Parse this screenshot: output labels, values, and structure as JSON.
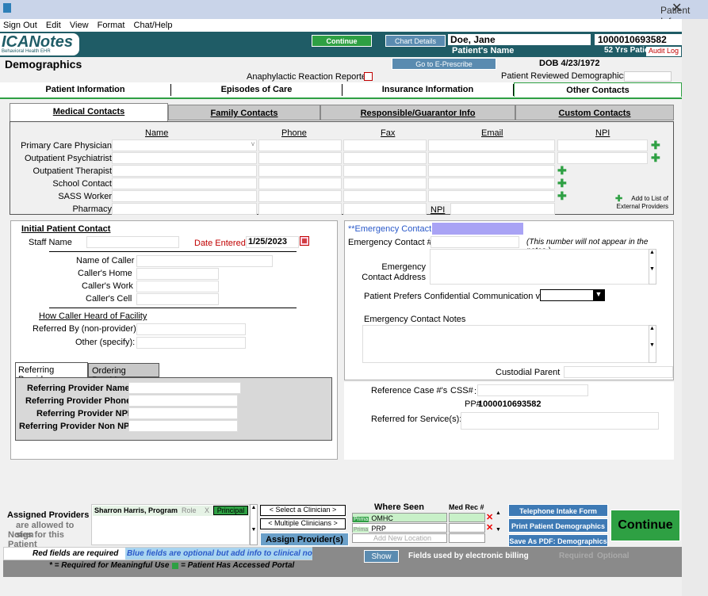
{
  "window": {
    "title": "Patient Info"
  },
  "menu": [
    "Sign Out",
    "Edit",
    "View",
    "Format",
    "Chat/Help"
  ],
  "header": {
    "logo": "ICANotes",
    "logo_sub": "Behavioral Health EHR",
    "continue": "Continue",
    "chart_details": "Chart Details",
    "patient_name": "Doe, Jane",
    "patient_name_label": "Patient's Name",
    "patient_id": "1000010693582",
    "age": "52 Yrs",
    "patient_id_label": "Patient's ID",
    "audit_log": "Audit Log",
    "eprescribe": "Go to E-Prescribe",
    "dob": "DOB 4/23/1972"
  },
  "page": {
    "title": "Demographics",
    "anaphylactic": "Anaphylactic Reaction Reported",
    "reviewed": "Patient Reviewed Demographics"
  },
  "tabs": [
    "Patient Information",
    "Episodes of Care",
    "Insurance Information",
    "Other Contacts"
  ],
  "subtabs": [
    "Medical Contacts",
    "Family Contacts",
    "Responsible/Guarantor Info",
    "Custom Contacts"
  ],
  "contacts": {
    "headers": {
      "name": "Name",
      "phone": "Phone",
      "fax": "Fax",
      "email": "Email",
      "npi": "NPI"
    },
    "rows": [
      "Primary Care Physician",
      "Outpatient Psychiatrist",
      "Outpatient Therapist",
      "School Contact",
      "SASS Worker",
      "Pharmacy"
    ],
    "npi_label": "NPI",
    "add_external": "Add to List of External Providers"
  },
  "initial": {
    "title": "Initial Patient Contact",
    "staff_name": "Staff Name",
    "date_entered_label": "Date Entered",
    "date_entered": "1/25/2023",
    "caller_name": "Name of Caller",
    "caller_home": "Caller's Home",
    "caller_work": "Caller's Work",
    "caller_cell": "Caller's Cell",
    "how_heard": "How Caller Heard of Facility",
    "referred_by": "Referred By (non-provider):",
    "other": "Other (specify):"
  },
  "referring": {
    "tab1": "Referring Provider",
    "tab2": "Ordering Provider",
    "name": "Referring Provider Name:",
    "phone": "Referring Provider Phone:",
    "npi": "Referring Provider NPI:",
    "non_npi": "Referring Provider Non NPI:"
  },
  "emergency": {
    "contact": "**Emergency Contact",
    "contact_num": "Emergency Contact #",
    "note": "(This number will not appear in the notes.)",
    "address": "Emergency Contact Address",
    "prefers": "Patient Prefers Confidential Communication via",
    "notes": "Emergency Contact Notes",
    "custodial": "Custodial Parent"
  },
  "reference": {
    "case": "Reference Case #'s",
    "css": "CSS#",
    "pp": "PP#",
    "pp_value": "1000010693582",
    "referred_service": "Referred for Service(s):"
  },
  "assigned": {
    "title": "Assigned Providers",
    "sub1": "are allowed to sign",
    "sub2": "Notes for this Patient",
    "provider": "Sharron Harris, Program",
    "role": "Role",
    "x": "X",
    "principal": "Principal",
    "select_clinician": "< Select a Clinician >",
    "multiple": "< Multiple Clinicians >",
    "assign": "Assign Provider(s)"
  },
  "where": {
    "title": "Where Seen",
    "medrec": "Med Rec #",
    "loc1": "OMHC",
    "loc2": "PRP",
    "prim": "Prima",
    "add": "Add New Location"
  },
  "actions": {
    "intake": "Telephone Intake Form",
    "print": "Print Patient Demographics",
    "pdf": "Save As PDF: Demographics",
    "continue": "Continue"
  },
  "legend": {
    "red": "Red fields are required",
    "blue": "Blue fields are optional but add info to clinical note.",
    "mu": "* = Required for Meaningful Use",
    "portal": "= Patient Has Accessed Portal",
    "show": "Show",
    "billing": "Fields used by electronic billing",
    "required": "Required",
    "optional": "Optional"
  },
  "colors": {
    "teal": "#1f5c66",
    "green": "#2ea043",
    "lavender": "#a9a3f5",
    "blue": "#5a8bb0"
  }
}
